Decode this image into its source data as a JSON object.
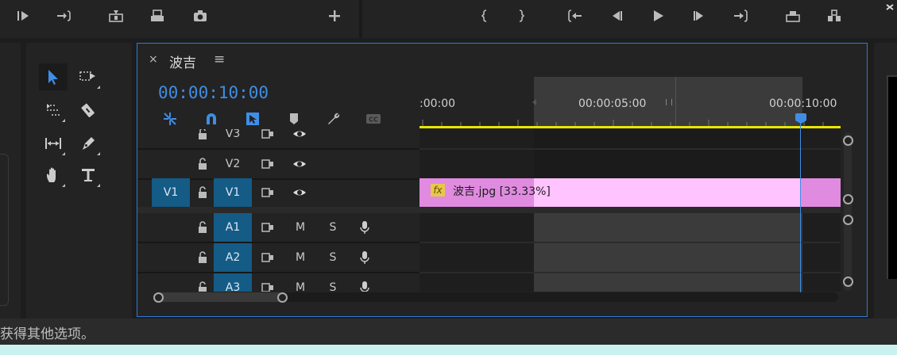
{
  "timeline": {
    "close": "×",
    "title": "波吉",
    "menu": "≡",
    "timecode": "00:00:10:00",
    "ruler_labels": [
      ":00:00",
      "00:00:05:00",
      "00:00:10:00"
    ]
  },
  "tracks": {
    "video": [
      {
        "name": "V3"
      },
      {
        "name": "V2"
      },
      {
        "name": "V1",
        "source": "V1"
      }
    ],
    "audio": [
      {
        "name": "A1",
        "mute": "M",
        "solo": "S"
      },
      {
        "name": "A2",
        "mute": "M",
        "solo": "S"
      },
      {
        "name": "A3",
        "mute": "M",
        "solo": "S"
      }
    ]
  },
  "clip": {
    "fx": "fx",
    "label": "波吉.jpg [33.33%]"
  },
  "status": {
    "text": "获得其他选项。"
  },
  "colors": {
    "accent": "#3f8ee6",
    "clip": "#ffc3ff",
    "track_selected": "#145b86",
    "work_area_bar": "#e8e600"
  }
}
